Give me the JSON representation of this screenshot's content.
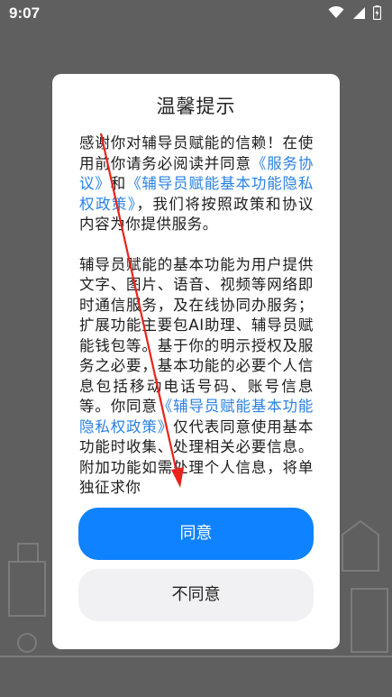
{
  "status_bar": {
    "time": "9:07",
    "icons": [
      "wifi-icon",
      "signal-icon",
      "battery-icon"
    ]
  },
  "dialog": {
    "title": "温馨提示",
    "paragraph1": {
      "t1": "感谢你对辅导员赋能的信赖！在使用前你请务必阅读并同意",
      "link1": "《服务协议》",
      "t2": "和",
      "link2": "《辅导员赋能基本功能隐私权政策》",
      "t3": "，我们将按照政策和协议内容为你提供服务。"
    },
    "paragraph2": {
      "t1": "辅导员赋能的基本功能为用户提供文字、图片、语音、视频等网络即时通信服务，及在线协同办服务；扩展功能主要包AI助理、辅导员赋能钱包等。基于你的明示授权及服务之必要，基本功能的必要个人信息包括移动电话号码、账号信息等。你同意",
      "link1": "《辅导员赋能基本功能隐私权政策》",
      "t2": "仅代表同意使用基本功能时收集、处理相关必要信息。附加功能如需处理个人信息，将单独征求你"
    },
    "agree_label": "同意",
    "disagree_label": "不同意"
  },
  "colors": {
    "primary": "#0f82ff",
    "link": "#2a82e4",
    "annotation_arrow": "#e8231b",
    "scrim": "#5f5f5f"
  }
}
